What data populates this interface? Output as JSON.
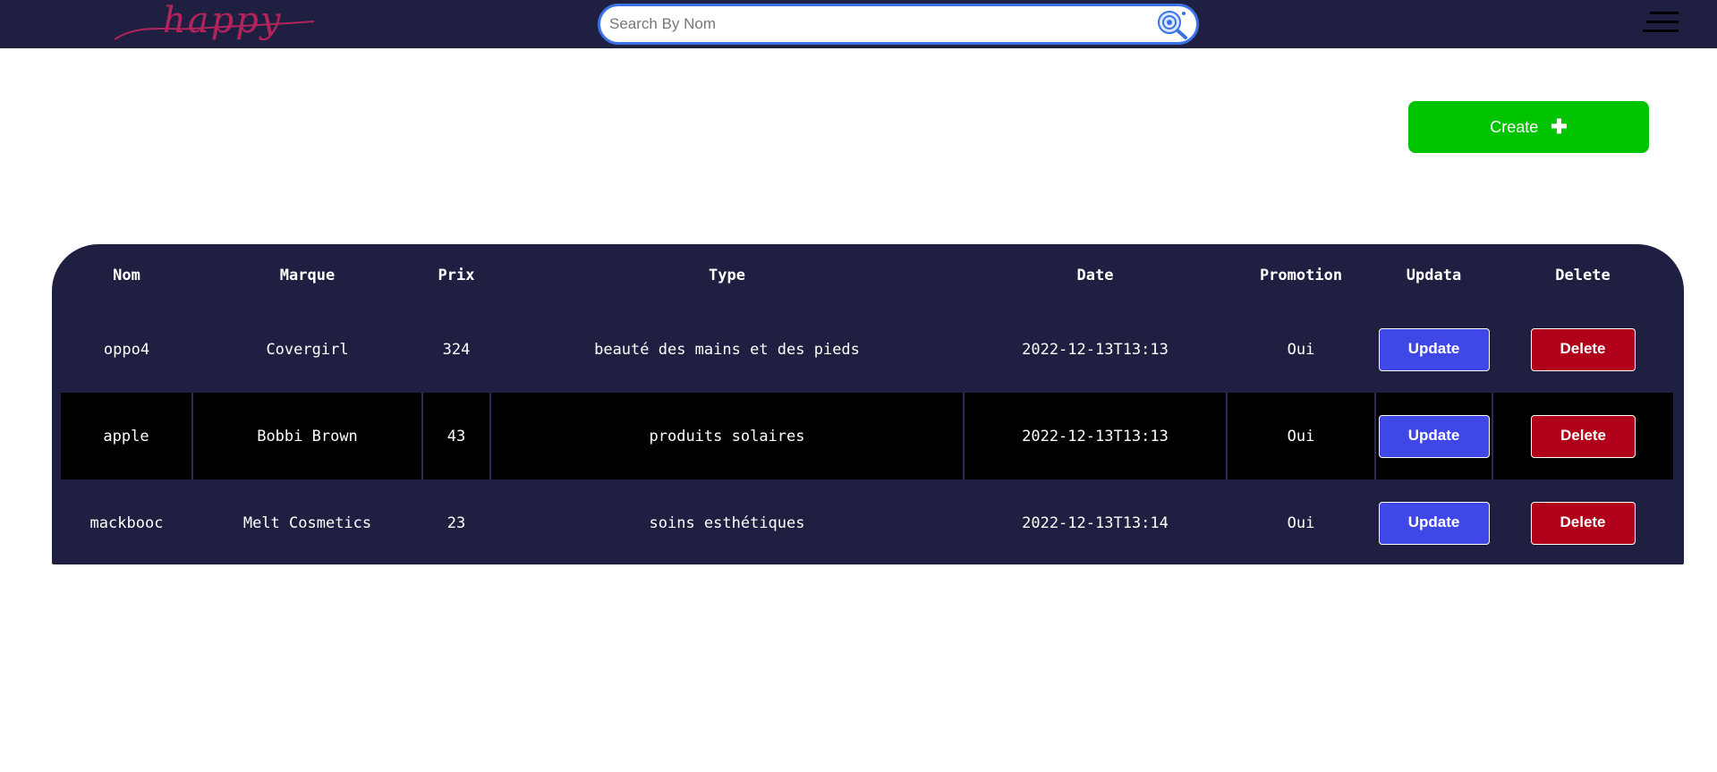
{
  "navbar": {
    "logo_text": "happy",
    "search_placeholder": "Search By Nom",
    "search_value": ""
  },
  "actions": {
    "create_label": "Create",
    "create_icon": "plus-icon"
  },
  "table": {
    "headers": [
      "Nom",
      "Marque",
      "Prix",
      "Type",
      "Date",
      "Promotion",
      "Updata",
      "Delete"
    ],
    "rows": [
      {
        "nom": "oppo4",
        "marque": "Covergirl",
        "prix": "324",
        "type": "beauté des mains et des pieds",
        "date": "2022-12-13T13:13",
        "promotion": "Oui",
        "update_label": "Update",
        "delete_label": "Delete"
      },
      {
        "nom": "apple",
        "marque": "Bobbi Brown",
        "prix": "43",
        "type": "produits solaires",
        "date": "2022-12-13T13:13",
        "promotion": "Oui",
        "update_label": "Update",
        "delete_label": "Delete"
      },
      {
        "nom": "mackbooc",
        "marque": "Melt Cosmetics",
        "prix": "23",
        "type": "soins esthétiques",
        "date": "2022-12-13T13:14",
        "promotion": "Oui",
        "update_label": "Update",
        "delete_label": "Delete"
      }
    ]
  },
  "colors": {
    "navbar_bg": "#1f1f42",
    "logo": "#b3245a",
    "create_button": "#00c400",
    "update_button": "#3f48e6",
    "delete_button": "#b0001a",
    "highlight_row": "#000000"
  }
}
